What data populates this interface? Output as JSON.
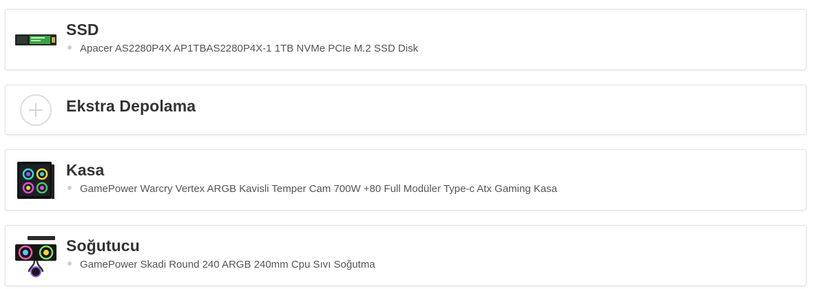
{
  "components": [
    {
      "title": "SSD",
      "detail": "Apacer AS2280P4X AP1TBAS2280P4X-1 1TB NVMe PCIe M.2 SSD Disk",
      "image": "ssd-m2-icon"
    },
    {
      "title": "Ekstra Depolama",
      "detail": "",
      "image": "add-circle-icon"
    },
    {
      "title": "Kasa",
      "detail": "GamePower Warcry Vertex ARGB Kavisli Temper Cam 700W +80 Full Modüler Type-c Atx Gaming Kasa",
      "image": "pc-case-icon"
    },
    {
      "title": "Soğutucu",
      "detail": "GamePower Skadi Round 240 ARGB 240mm Cpu Sıvı Soğutma",
      "image": "liquid-cooler-icon"
    }
  ]
}
